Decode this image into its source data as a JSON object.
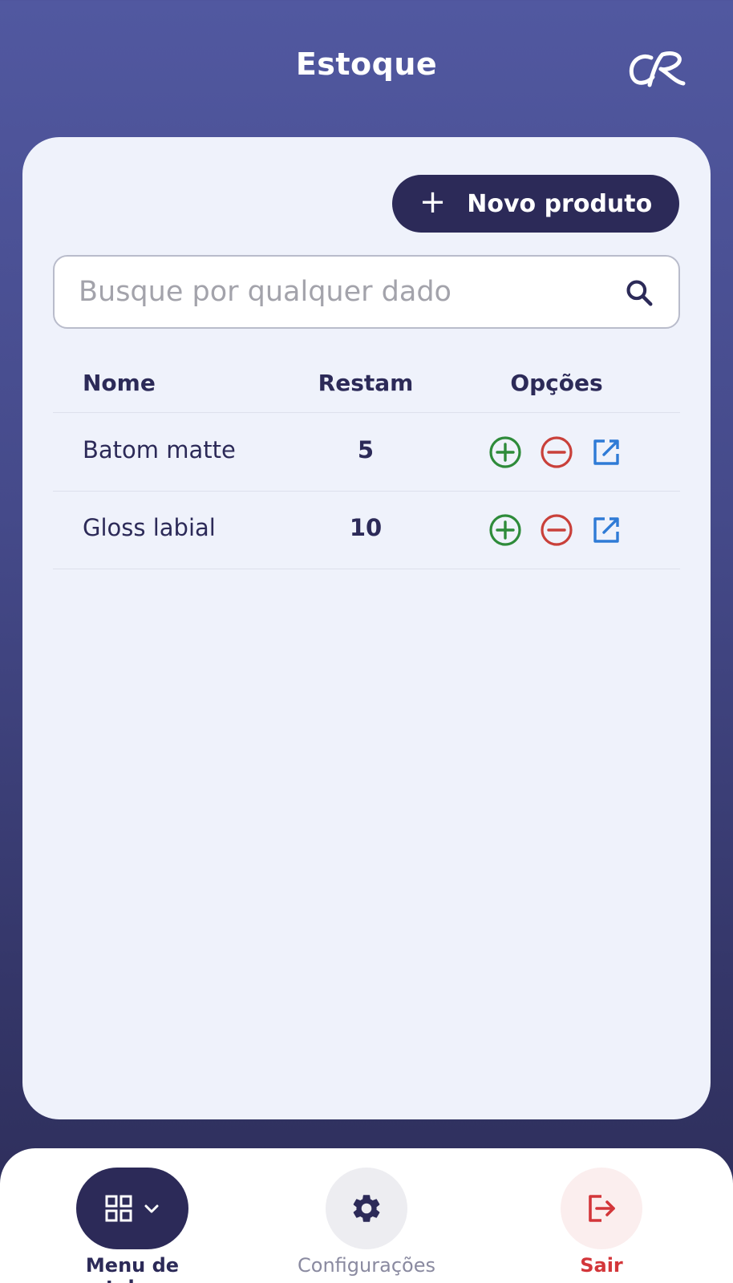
{
  "header": {
    "title": "Estoque",
    "logo_icon": "cr-monogram-logo"
  },
  "toolbar": {
    "new_product_label": "Novo produto",
    "new_product_icon": "plus-icon"
  },
  "search": {
    "placeholder": "Busque por qualquer dado",
    "value": "",
    "icon": "search-icon"
  },
  "table": {
    "headers": {
      "name": "Nome",
      "remaining": "Restam",
      "options": "Opções"
    },
    "rows": [
      {
        "name": "Batom matte",
        "remaining": "5"
      },
      {
        "name": "Gloss labial",
        "remaining": "10"
      }
    ]
  },
  "nav": {
    "menu": {
      "label": "Menu de telas",
      "icon": "grid-icon"
    },
    "settings": {
      "label": "Configurações",
      "icon": "gear-icon"
    },
    "logout": {
      "label": "Sair",
      "icon": "logout-icon"
    }
  },
  "colors": {
    "primary": "#2c2a58",
    "add": "#2e8b3a",
    "remove": "#c9403a",
    "edit": "#2f7bd6",
    "logout": "#d3363a",
    "muted": "#8a8aa0"
  }
}
